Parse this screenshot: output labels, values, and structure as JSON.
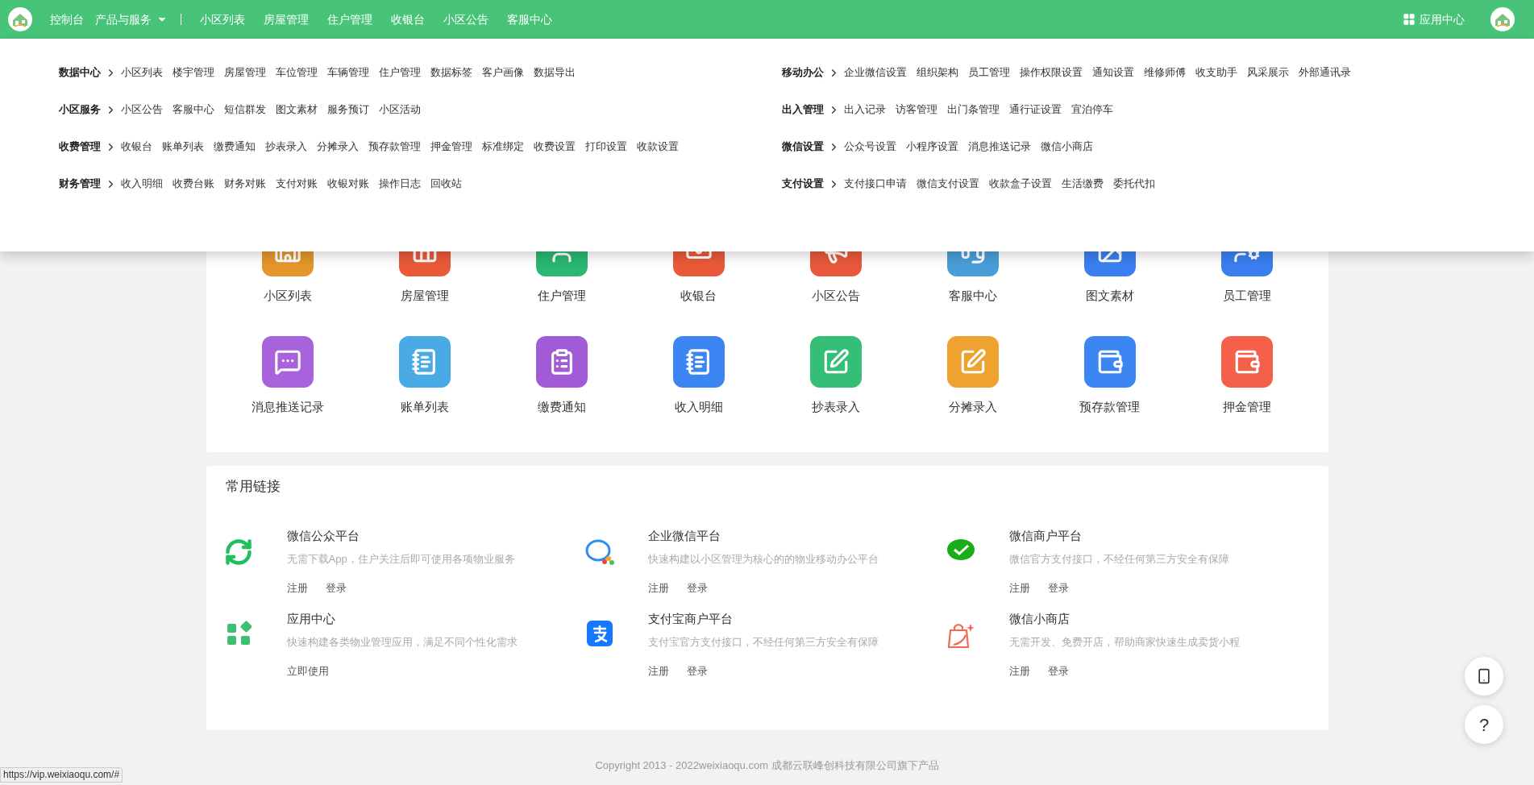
{
  "top_nav": {
    "home": "控制台",
    "menu_button": {
      "label": "产品与服务",
      "expanded": true
    },
    "links": [
      "小区列表",
      "房屋管理",
      "住户管理",
      "收银台",
      "小区公告",
      "客服中心"
    ],
    "app_center": "应用中心"
  },
  "mega_menu": {
    "columns": [
      [
        {
          "title": "数据中心",
          "items": [
            "小区列表",
            "楼宇管理",
            "房屋管理",
            "车位管理",
            "车辆管理",
            "住户管理",
            "数据标签",
            "客户画像",
            "数据导出"
          ]
        },
        {
          "title": "小区服务",
          "items": [
            "小区公告",
            "客服中心",
            "短信群发",
            "图文素材",
            "服务预订",
            "小区活动"
          ]
        },
        {
          "title": "收费管理",
          "items": [
            "收银台",
            "账单列表",
            "缴费通知",
            "抄表录入",
            "分摊录入",
            "预存款管理",
            "押金管理",
            "标准绑定",
            "收费设置",
            "打印设置",
            "收款设置"
          ]
        },
        {
          "title": "财务管理",
          "items": [
            "收入明细",
            "收费台账",
            "财务对账",
            "支付对账",
            "收银对账",
            "操作日志",
            "回收站"
          ]
        }
      ],
      [
        {
          "title": "移动办公",
          "items": [
            "企业微信设置",
            "组织架构",
            "员工管理",
            "操作权限设置",
            "通知设置",
            "维修师傅",
            "收支助手",
            "风采展示",
            "外部通讯录"
          ]
        },
        {
          "title": "出入管理",
          "items": [
            "出入记录",
            "访客管理",
            "出门条管理",
            "通行证设置",
            "宜泊停车"
          ]
        },
        {
          "title": "微信设置",
          "items": [
            "公众号设置",
            "小程序设置",
            "消息推送记录",
            "微信小商店"
          ]
        },
        {
          "title": "支付设置",
          "items": [
            "支付接口申请",
            "微信支付设置",
            "收款盒子设置",
            "生活缴费",
            "委托代扣"
          ]
        }
      ]
    ]
  },
  "features": [
    {
      "label": "小区列表",
      "kind": "building",
      "color": "#e3962a"
    },
    {
      "label": "房屋管理",
      "kind": "house",
      "color": "#ea5a38"
    },
    {
      "label": "住户管理",
      "kind": "user",
      "color": "#2ab673"
    },
    {
      "label": "收银台",
      "kind": "cash",
      "color": "#ea5a38"
    },
    {
      "label": "小区公告",
      "kind": "megaphone",
      "color": "#e9583a"
    },
    {
      "label": "客服中心",
      "kind": "headset",
      "color": "#4a9ed8"
    },
    {
      "label": "图文素材",
      "kind": "image",
      "color": "#3a7ff0"
    },
    {
      "label": "员工管理",
      "kind": "usercog",
      "color": "#3a7ff0"
    },
    {
      "label": "消息推送记录",
      "kind": "message",
      "color": "#a862dc"
    },
    {
      "label": "账单列表",
      "kind": "notebook",
      "color": "#4aaae6"
    },
    {
      "label": "缴费通知",
      "kind": "clipboard",
      "color": "#a25bd6"
    },
    {
      "label": "收入明细",
      "kind": "notebook",
      "color": "#3b86f3"
    },
    {
      "label": "抄表录入",
      "kind": "pen",
      "color": "#35bf76"
    },
    {
      "label": "分摊录入",
      "kind": "pen",
      "color": "#eea22f"
    },
    {
      "label": "预存款管理",
      "kind": "bag",
      "color": "#3b86f3"
    },
    {
      "label": "押金管理",
      "kind": "bag",
      "color": "#f4604a"
    }
  ],
  "links_card": {
    "title": "常用链接",
    "items": [
      {
        "kind": "wechat",
        "title": "微信公众平台",
        "description": "无需下载App，住户关注后即可使用各项物业服务",
        "actions": [
          "注册",
          "登录"
        ]
      },
      {
        "kind": "wecom",
        "title": "企业微信平台",
        "description": "快速构建以小区管理为核心的的物业移动办公平台",
        "actions": [
          "注册",
          "登录"
        ]
      },
      {
        "kind": "wechatpay",
        "title": "微信商户平台",
        "description": "微信官方支付接口，不经任何第三方安全有保障",
        "actions": [
          "注册",
          "登录"
        ]
      },
      {
        "kind": "apps",
        "title": "应用中心",
        "description": "快速构建各类物业管理应用，满足不同个性化需求",
        "actions": [
          "立即使用"
        ]
      },
      {
        "kind": "alipay",
        "title": "支付宝商户平台",
        "description": "支付宝官方支付接口，不经任何第三方安全有保障",
        "actions": [
          "注册",
          "登录"
        ]
      },
      {
        "kind": "shop",
        "title": "微信小商店",
        "description": "无需开发、免费开店，帮助商家快速生成卖货小程",
        "actions": [
          "注册",
          "登录"
        ]
      }
    ]
  },
  "footer": "Copyright 2013 - 2022weixiaoqu.com 成都云联峰创科技有限公司旗下产品",
  "help_button": "?",
  "status_url": "https://vip.weixiaoqu.com/#"
}
